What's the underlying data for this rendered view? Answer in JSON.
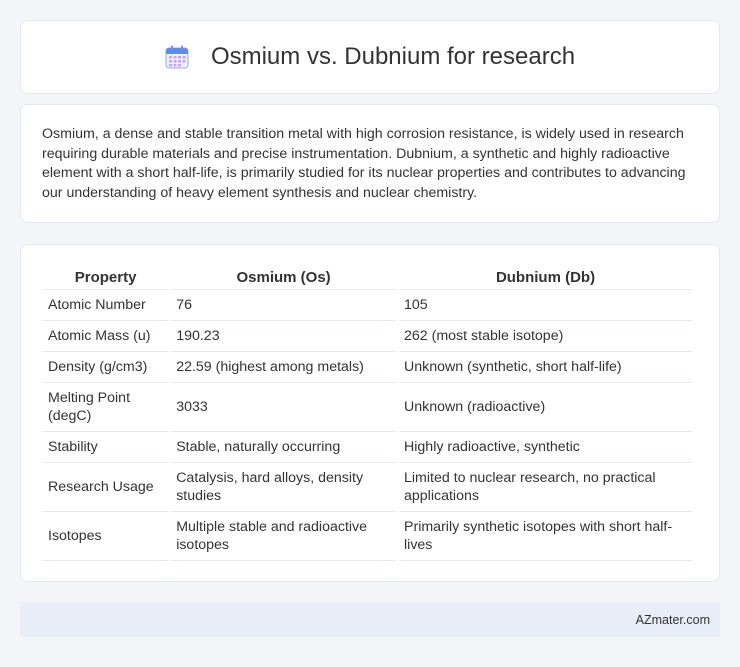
{
  "header": {
    "title": "Osmium vs. Dubnium for research",
    "icon": "calendar-icon",
    "icon_color": "#5b8def"
  },
  "intro": {
    "text": "Osmium, a dense and stable transition metal with high corrosion resistance, is widely used in research requiring durable materials and precise instrumentation. Dubnium, a synthetic and highly radioactive element with a short half-life, is primarily studied for its nuclear properties and contributes to advancing our understanding of heavy element synthesis and nuclear chemistry."
  },
  "table": {
    "headers": [
      "Property",
      "Osmium (Os)",
      "Dubnium (Db)"
    ],
    "rows": [
      [
        "Atomic Number",
        "76",
        "105"
      ],
      [
        "Atomic Mass (u)",
        "190.23",
        "262 (most stable isotope)"
      ],
      [
        "Density (g/cm3)",
        "22.59 (highest among metals)",
        "Unknown (synthetic, short half-life)"
      ],
      [
        "Melting Point (degC)",
        "3033",
        "Unknown (radioactive)"
      ],
      [
        "Stability",
        "Stable, naturally occurring",
        "Highly radioactive, synthetic"
      ],
      [
        "Research Usage",
        "Catalysis, hard alloys, density studies",
        "Limited to nuclear research, no practical applications"
      ],
      [
        "Isotopes",
        "Multiple stable and radioactive isotopes",
        "Primarily synthetic isotopes with short half-lives"
      ]
    ]
  },
  "footer": {
    "brand": "AZmater.com"
  }
}
